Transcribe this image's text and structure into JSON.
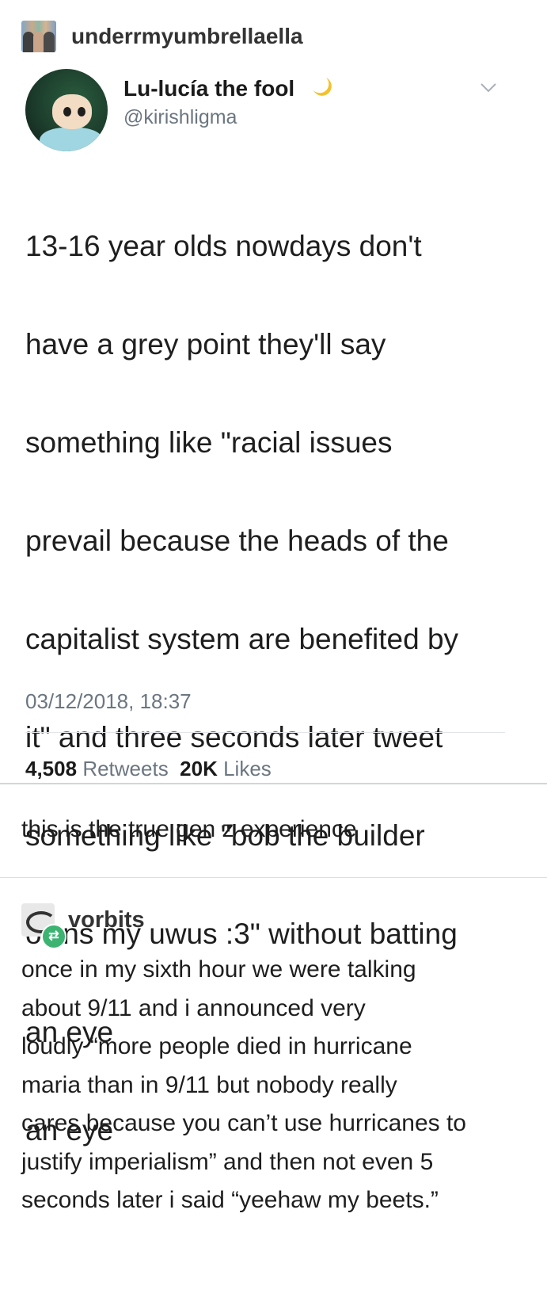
{
  "reblogger": {
    "name": "underrmyumbrellaella"
  },
  "tweet": {
    "display_name": "Lu-lucía the fool",
    "handle": "@kirishligma",
    "lines": [
      "13-16 year olds nowdays don't",
      "have a grey point they'll say",
      "something like \"racial issues",
      "prevail because the heads of the",
      "capitalist system are benefited by",
      "it\" and three seconds later tweet",
      "something like \"bob the builder",
      "owns my uwus :3\" without batting",
      "an eye",
      "an eye"
    ],
    "timestamp": "03/12/2018, 18:37",
    "retweets_count": "4,508",
    "retweets_label": "Retweets",
    "likes_count": "20K",
    "likes_label": "Likes"
  },
  "comment1": {
    "text": "this is the true gen z experience"
  },
  "reblog2": {
    "name": "vorbits",
    "lines": [
      "once in my sixth hour we were talking",
      "about 9/11 and i announced very",
      "loudly “more people died in hurricane",
      "maria than in 9/11 but nobody really",
      "cares because you can’t use hurricanes to",
      "justify imperialism” and then not even 5",
      "seconds later i said “yeehaw my beets.”"
    ]
  },
  "icons": {
    "moon": "crescent-moon-icon",
    "chevron": "chevron-down-icon",
    "reblog": "reblog-icon"
  },
  "colors": {
    "accent": "#3cb371",
    "muted": "#6b7680"
  }
}
